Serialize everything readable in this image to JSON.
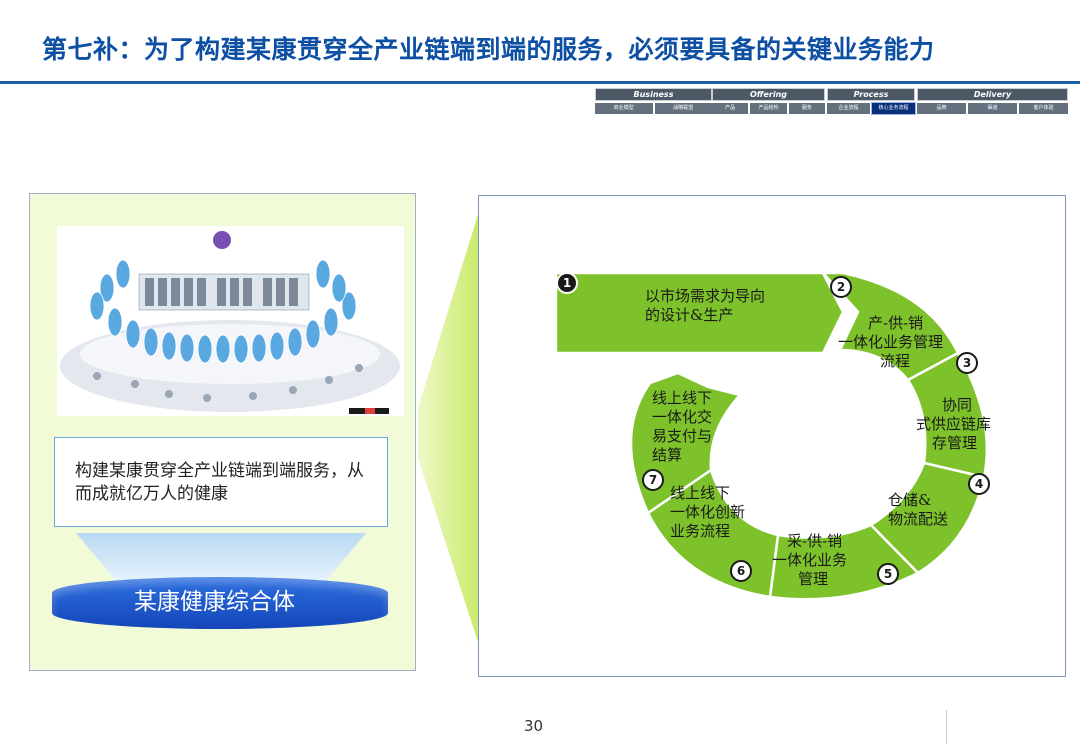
{
  "title": "第七补：为了构建某康贯穿全产业链端到端的服务，必须要具备的关键业务能力",
  "nav": {
    "groups": [
      {
        "label": "Business",
        "items": [
          "商业模型",
          "战略联盟"
        ]
      },
      {
        "label": "Offering",
        "items": [
          "产品",
          "产品结构",
          "服务"
        ]
      },
      {
        "label": "Process",
        "items": [
          "企业流程",
          "核心业务流程"
        ]
      },
      {
        "label": "Delivery",
        "items": [
          "品牌",
          "渠道",
          "客户体验"
        ]
      }
    ],
    "active": "核心业务流程"
  },
  "left": {
    "image_desc_icon": "ecosystem-diagram-image",
    "caption": "构建某康贯穿全产业链端到端服务，从而成就亿万人的健康",
    "platform_label": "某康健康综合体"
  },
  "cycle": {
    "fill_color": "#7ec22b",
    "segments": [
      {
        "num": "1",
        "text": [
          "以市场需求为导向",
          "的设计&生产"
        ]
      },
      {
        "num": "2",
        "text": [
          "产-供-销",
          "一体化业务管理",
          "流程"
        ]
      },
      {
        "num": "3",
        "text": [
          "协同",
          "式供应链库",
          "存管理"
        ]
      },
      {
        "num": "4",
        "text": [
          "仓储&",
          "物流配送"
        ]
      },
      {
        "num": "5",
        "text": [
          "采-供-销",
          "一体化业务",
          "管理"
        ]
      },
      {
        "num": "6",
        "text": [
          "线上线下",
          "一体化创新",
          "业务流程"
        ]
      },
      {
        "num": "7",
        "text": [
          "线上线下",
          "一体化交",
          "易支付与",
          "结算"
        ]
      }
    ]
  },
  "page_number": "30"
}
